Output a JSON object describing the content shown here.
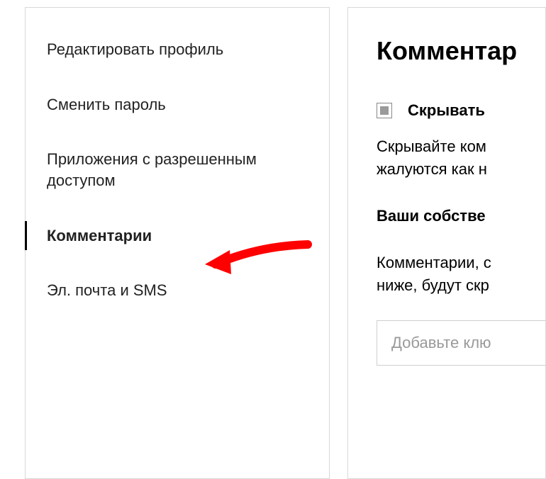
{
  "sidebar": {
    "items": [
      {
        "label": "Редактировать профиль",
        "active": false
      },
      {
        "label": "Сменить пароль",
        "active": false
      },
      {
        "label": "Приложения с разрешенным доступом",
        "active": false
      },
      {
        "label": "Комментарии",
        "active": true
      },
      {
        "label": "Эл. почта и SMS",
        "active": false
      }
    ]
  },
  "main": {
    "title": "Комментар",
    "checkbox_label": "Скрывать",
    "desc_line1": "Скрывайте ком",
    "desc_line2": "жалуются как н",
    "subheading": "Ваши собстве",
    "desc2_line1": "Комментарии, с",
    "desc2_line2": "ниже, будут скр",
    "input_placeholder": "Добавьте клю"
  },
  "annotation": {
    "arrow_color": "#ff0000"
  }
}
